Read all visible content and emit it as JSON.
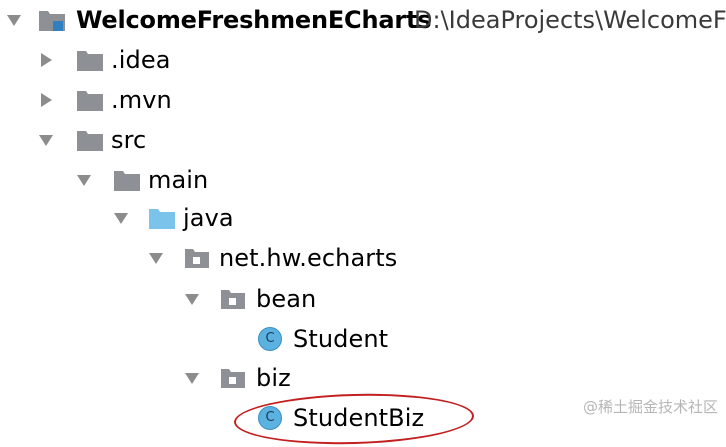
{
  "project_tree": {
    "root": {
      "name": "WelcomeFreshmenECharts",
      "path": "D:\\IdeaProjects\\WelcomeF"
    },
    "nodes": [
      {
        "label": ".idea",
        "kind": "folder",
        "expanded": false
      },
      {
        "label": ".mvn",
        "kind": "folder",
        "expanded": false
      },
      {
        "label": "src",
        "kind": "folder",
        "expanded": true
      },
      {
        "label": "main",
        "kind": "folder",
        "expanded": true
      },
      {
        "label": "java",
        "kind": "source-root",
        "expanded": true
      },
      {
        "label": "net.hw.echarts",
        "kind": "package",
        "expanded": true
      },
      {
        "label": "bean",
        "kind": "package",
        "expanded": true
      },
      {
        "label": "Student",
        "kind": "class",
        "icon_letter": "C"
      },
      {
        "label": "biz",
        "kind": "package",
        "expanded": true
      },
      {
        "label": "StudentBiz",
        "kind": "class",
        "icon_letter": "C",
        "highlighted": true
      }
    ]
  },
  "colors": {
    "folder": "#8d9095",
    "source_root": "#7cc3ec",
    "class_icon": "#5bb2e0",
    "highlight_ring": "#c41f1f",
    "arrow": "#8c8c8c"
  },
  "watermark": "@稀土掘金技术社区"
}
